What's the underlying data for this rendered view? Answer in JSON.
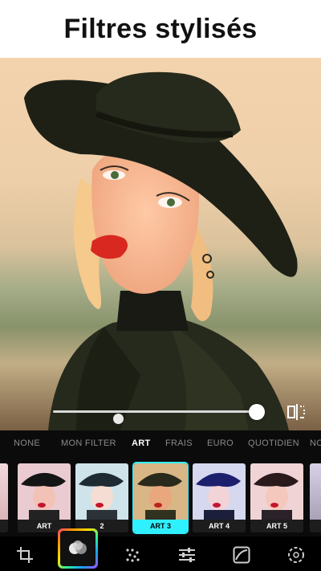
{
  "header": {
    "title": "Filtres stylisés"
  },
  "filter_tabs": [
    {
      "label": "NONE",
      "active": false
    },
    {
      "label": "MON FILTER",
      "active": false
    },
    {
      "label": "ART",
      "active": true
    },
    {
      "label": "FRAIS",
      "active": false
    },
    {
      "label": "EURO",
      "active": false
    },
    {
      "label": "QUOTIDIEN",
      "active": false
    },
    {
      "label": "NO",
      "active": false
    }
  ],
  "filters": [
    {
      "label": "",
      "selected": false
    },
    {
      "label": "ART",
      "selected": false
    },
    {
      "label": "2",
      "selected": false
    },
    {
      "label": "ART 3",
      "selected": true
    },
    {
      "label": "ART 4",
      "selected": false
    },
    {
      "label": "ART 5",
      "selected": false
    }
  ],
  "intensity_slider": {
    "value": 1.0
  },
  "toolbar": {
    "items": [
      "crop-icon",
      "filters-icon",
      "effects-icon",
      "adjust-icon",
      "curves-icon",
      "aperture-icon"
    ]
  },
  "colors": {
    "accent": "#2ff0ff",
    "selected_label_text": "#000000"
  }
}
